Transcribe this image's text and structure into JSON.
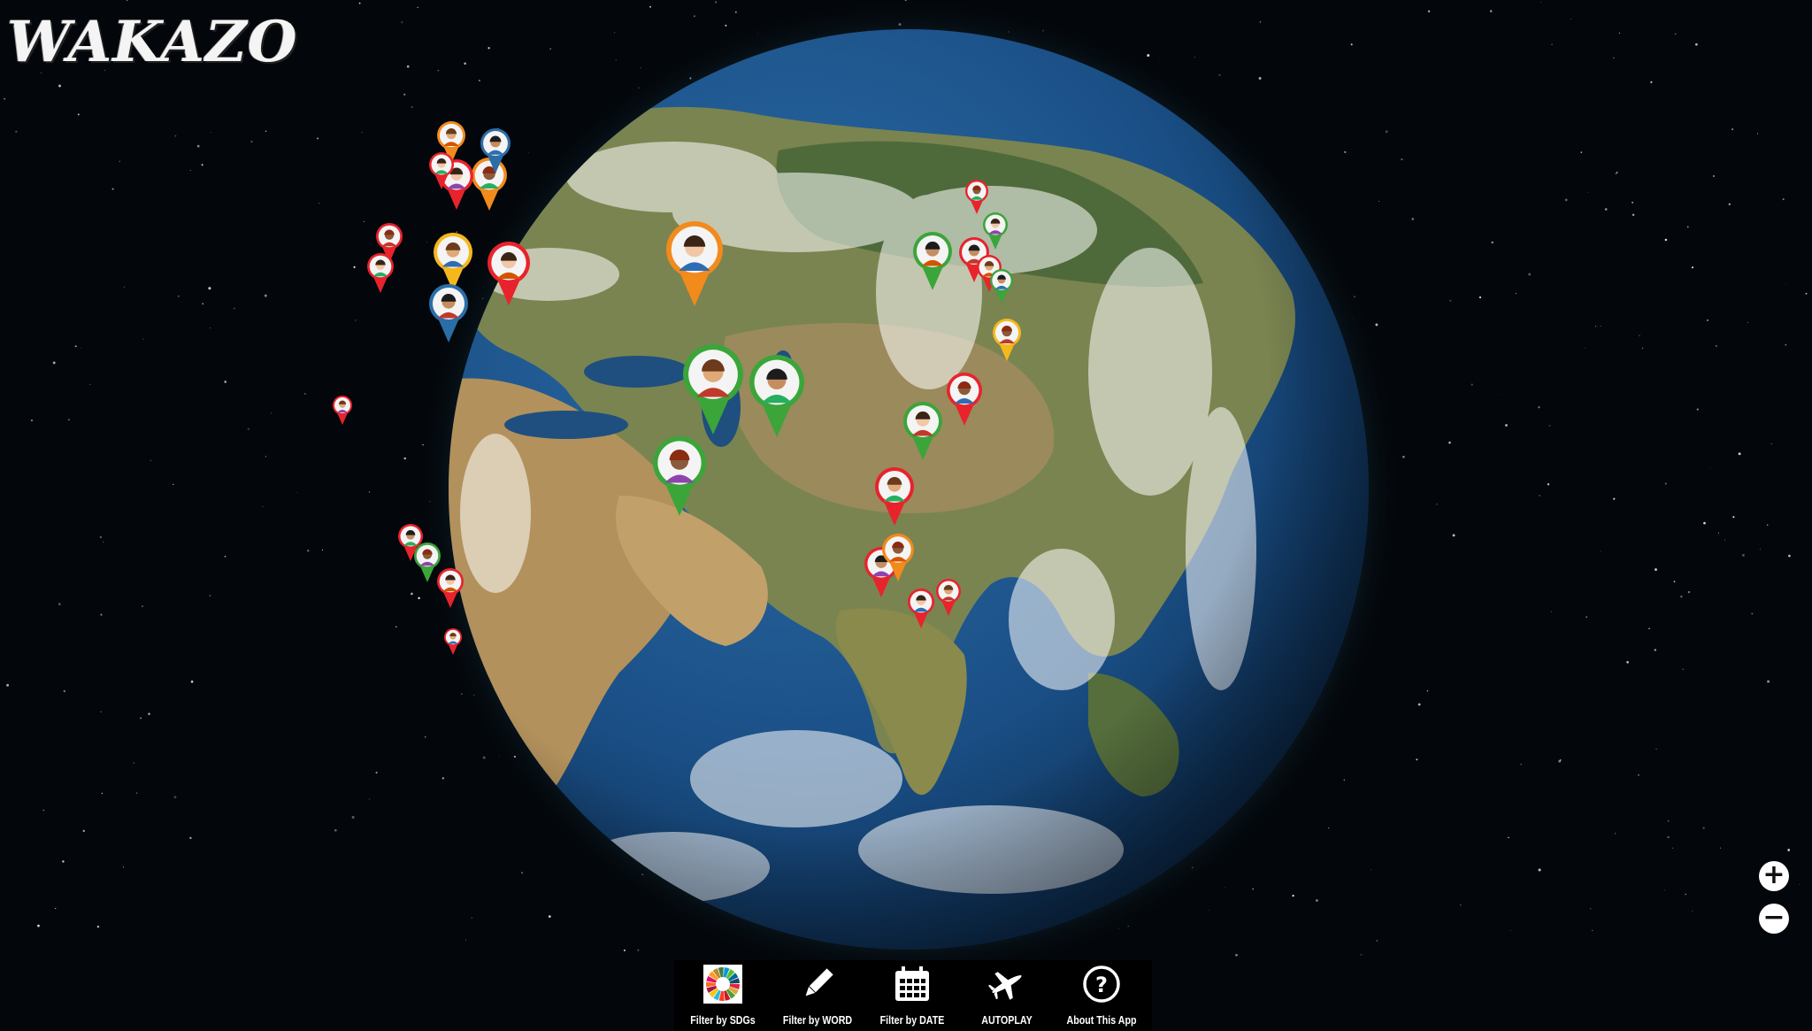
{
  "app": {
    "logo_text": "WAKAZO"
  },
  "zoom": {
    "in_symbol": "+",
    "out_symbol": "−"
  },
  "toolbar": {
    "items": [
      {
        "label": "Filter by SDGs",
        "icon": "sdg-wheel-icon"
      },
      {
        "label": "Filter by WORD",
        "icon": "pencil-icon"
      },
      {
        "label": "Filter by DATE",
        "icon": "calendar-icon"
      },
      {
        "label": "AUTOPLAY",
        "icon": "airplane-icon"
      },
      {
        "label": "About This App",
        "icon": "help-icon"
      }
    ]
  },
  "marker_colors": {
    "red": "#e8232c",
    "orange": "#f28a1c",
    "green": "#3ba53a",
    "yellow": "#f5b81c",
    "blue": "#2a6ea8"
  },
  "globe_markers": [
    {
      "color": "orange",
      "avatar": "person-afro-icon"
    },
    {
      "color": "green",
      "avatar": "person-woman-red-hair-icon"
    },
    {
      "color": "green",
      "avatar": "person-hardhat-icon"
    },
    {
      "color": "green",
      "avatar": "person-photo-icon"
    },
    {
      "color": "red",
      "avatar": "person-photo-icon"
    },
    {
      "color": "yellow",
      "avatar": "person-cap-icon"
    },
    {
      "color": "blue",
      "avatar": "person-elder-icon"
    },
    {
      "color": "orange",
      "avatar": "person-glasses-icon"
    },
    {
      "color": "red",
      "avatar": "person-woman-icon"
    },
    {
      "color": "orange",
      "avatar": "person-woman-icon"
    },
    {
      "color": "blue",
      "avatar": "person-red-hair-icon"
    },
    {
      "color": "red",
      "avatar": "person-man-icon"
    },
    {
      "color": "red",
      "avatar": "person-cap-icon"
    },
    {
      "color": "red",
      "avatar": "person-photo-icon"
    },
    {
      "color": "green",
      "avatar": "person-photo-icon"
    },
    {
      "color": "red",
      "avatar": "person-photo-icon"
    },
    {
      "color": "green",
      "avatar": "person-photo-icon"
    },
    {
      "color": "red",
      "avatar": "person-woman-icon"
    },
    {
      "color": "red",
      "avatar": "person-photo-icon"
    },
    {
      "color": "orange",
      "avatar": "person-photo-icon"
    },
    {
      "color": "red",
      "avatar": "person-woman-icon"
    },
    {
      "color": "red",
      "avatar": "person-man-icon"
    },
    {
      "color": "red",
      "avatar": "person-man-icon"
    },
    {
      "color": "green",
      "avatar": "person-photo-icon"
    },
    {
      "color": "red",
      "avatar": "person-woman-icon"
    },
    {
      "color": "red",
      "avatar": "person-woman-icon"
    },
    {
      "color": "red",
      "avatar": "person-man-icon"
    },
    {
      "color": "red",
      "avatar": "person-man-icon"
    },
    {
      "color": "green",
      "avatar": "person-photo-icon"
    },
    {
      "color": "red",
      "avatar": "person-woman-icon"
    },
    {
      "color": "green",
      "avatar": "person-photo-icon"
    },
    {
      "color": "yellow",
      "avatar": "person-photo-icon"
    },
    {
      "color": "red",
      "avatar": "person-photo-icon"
    }
  ]
}
